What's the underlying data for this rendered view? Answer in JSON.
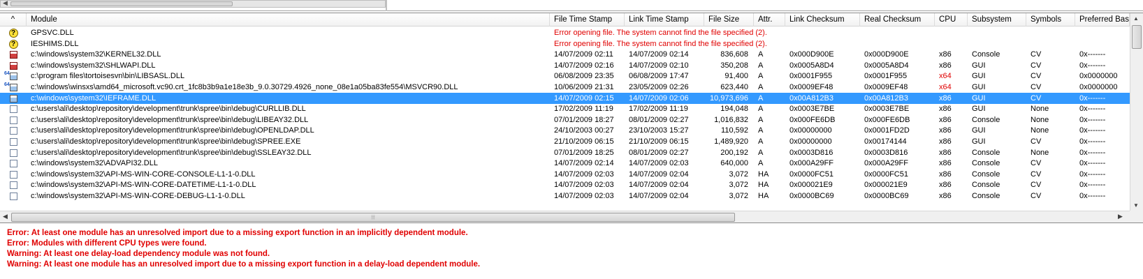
{
  "colors": {
    "error": "#e00000",
    "selection": "#3399ff"
  },
  "list": {
    "sort_indicator": "^",
    "columns": [
      "Module",
      "File Time Stamp",
      "Link Time Stamp",
      "File Size",
      "Attr.",
      "Link Checksum",
      "Real Checksum",
      "CPU",
      "Subsystem",
      "Symbols",
      "Preferred Base"
    ],
    "rows": [
      {
        "icon": "missing-module-icon",
        "module": "GPSVC.DLL",
        "error": "Error opening file. The system cannot find the file specified (2)."
      },
      {
        "icon": "missing-module-icon",
        "module": "IESHIMS.DLL",
        "error": "Error opening file. The system cannot find the file specified (2)."
      },
      {
        "icon": "error-module-icon",
        "module": "c:\\windows\\system32\\KERNEL32.DLL",
        "file_ts": "14/07/2009 02:11",
        "link_ts": "14/07/2009 02:14",
        "size": "836,608",
        "attr": "A",
        "link_cs": "0x000D900E",
        "real_cs": "0x000D900E",
        "cpu": "x86",
        "subsystem": "Console",
        "symbols": "CV",
        "base": "0x-------"
      },
      {
        "icon": "error-module-icon",
        "module": "c:\\windows\\system32\\SHLWAPI.DLL",
        "file_ts": "14/07/2009 02:16",
        "link_ts": "14/07/2009 02:10",
        "size": "350,208",
        "attr": "A",
        "link_cs": "0x0005A8D4",
        "real_cs": "0x0005A8D4",
        "cpu": "x86",
        "subsystem": "GUI",
        "symbols": "CV",
        "base": "0x-------"
      },
      {
        "icon": "module-64bit-icon",
        "module": "c:\\program files\\tortoisesvn\\bin\\LIBSASL.DLL",
        "file_ts": "06/08/2009 23:35",
        "link_ts": "06/08/2009 17:47",
        "size": "91,400",
        "attr": "A",
        "link_cs": "0x0001F955",
        "real_cs": "0x0001F955",
        "cpu": "x64",
        "cpu_warn": true,
        "subsystem": "GUI",
        "symbols": "CV",
        "base": "0x0000000"
      },
      {
        "icon": "module-64bit-icon",
        "module": "c:\\windows\\winsxs\\amd64_microsoft.vc90.crt_1fc8b3b9a1e18e3b_9.0.30729.4926_none_08e1a05ba83fe554\\MSVCR90.DLL",
        "file_ts": "10/06/2009 21:31",
        "link_ts": "23/05/2009 02:26",
        "size": "623,440",
        "attr": "A",
        "link_cs": "0x0009EF48",
        "real_cs": "0x0009EF48",
        "cpu": "x64",
        "cpu_warn": true,
        "subsystem": "GUI",
        "symbols": "CV",
        "base": "0x0000000"
      },
      {
        "icon": "module-selected-icon",
        "module": "c:\\windows\\system32\\IEFRAME.DLL",
        "file_ts": "14/07/2009 02:15",
        "link_ts": "14/07/2009 02:06",
        "size": "10,973,696",
        "attr": "A",
        "link_cs": "0x00A812B3",
        "real_cs": "0x00A812B3",
        "cpu": "x86",
        "subsystem": "GUI",
        "symbols": "CV",
        "base": "0x-------",
        "selected": true
      },
      {
        "icon": "module-icon",
        "module": "c:\\users\\ali\\desktop\\repository\\development\\trunk\\spree\\bin\\debug\\CURLLIB.DLL",
        "file_ts": "17/02/2009 11:19",
        "link_ts": "17/02/2009 11:19",
        "size": "194,048",
        "attr": "A",
        "link_cs": "0x0003E7BE",
        "real_cs": "0x0003E7BE",
        "cpu": "x86",
        "subsystem": "GUI",
        "symbols": "None",
        "base": "0x-------"
      },
      {
        "icon": "module-icon",
        "module": "c:\\users\\ali\\desktop\\repository\\development\\trunk\\spree\\bin\\debug\\LIBEAY32.DLL",
        "file_ts": "07/01/2009 18:27",
        "link_ts": "08/01/2009 02:27",
        "size": "1,016,832",
        "attr": "A",
        "link_cs": "0x000FE6DB",
        "real_cs": "0x000FE6DB",
        "cpu": "x86",
        "subsystem": "Console",
        "symbols": "None",
        "base": "0x-------"
      },
      {
        "icon": "module-icon",
        "module": "c:\\users\\ali\\desktop\\repository\\development\\trunk\\spree\\bin\\debug\\OPENLDAP.DLL",
        "file_ts": "24/10/2003 00:27",
        "link_ts": "23/10/2003 15:27",
        "size": "110,592",
        "attr": "A",
        "link_cs": "0x00000000",
        "real_cs": "0x0001FD2D",
        "cpu": "x86",
        "subsystem": "GUI",
        "symbols": "None",
        "base": "0x-------"
      },
      {
        "icon": "module-icon",
        "module": "c:\\users\\ali\\desktop\\repository\\development\\trunk\\spree\\bin\\debug\\SPREE.EXE",
        "file_ts": "21/10/2009 06:15",
        "link_ts": "21/10/2009 06:15",
        "size": "1,489,920",
        "attr": "A",
        "link_cs": "0x00000000",
        "real_cs": "0x00174144",
        "cpu": "x86",
        "subsystem": "GUI",
        "symbols": "CV",
        "base": "0x-------"
      },
      {
        "icon": "module-icon",
        "module": "c:\\users\\ali\\desktop\\repository\\development\\trunk\\spree\\bin\\debug\\SSLEAY32.DLL",
        "file_ts": "07/01/2009 18:25",
        "link_ts": "08/01/2009 02:27",
        "size": "200,192",
        "attr": "A",
        "link_cs": "0x0003D816",
        "real_cs": "0x0003D816",
        "cpu": "x86",
        "subsystem": "Console",
        "symbols": "None",
        "base": "0x-------"
      },
      {
        "icon": "module-icon",
        "module": "c:\\windows\\system32\\ADVAPI32.DLL",
        "file_ts": "14/07/2009 02:14",
        "link_ts": "14/07/2009 02:03",
        "size": "640,000",
        "attr": "A",
        "link_cs": "0x000A29FF",
        "real_cs": "0x000A29FF",
        "cpu": "x86",
        "subsystem": "Console",
        "symbols": "CV",
        "base": "0x-------"
      },
      {
        "icon": "module-icon",
        "module": "c:\\windows\\system32\\API-MS-WIN-CORE-CONSOLE-L1-1-0.DLL",
        "file_ts": "14/07/2009 02:03",
        "link_ts": "14/07/2009 02:04",
        "size": "3,072",
        "attr": "HA",
        "link_cs": "0x0000FC51",
        "real_cs": "0x0000FC51",
        "cpu": "x86",
        "subsystem": "Console",
        "symbols": "CV",
        "base": "0x-------"
      },
      {
        "icon": "module-icon",
        "module": "c:\\windows\\system32\\API-MS-WIN-CORE-DATETIME-L1-1-0.DLL",
        "file_ts": "14/07/2009 02:03",
        "link_ts": "14/07/2009 02:04",
        "size": "3,072",
        "attr": "HA",
        "link_cs": "0x000021E9",
        "real_cs": "0x000021E9",
        "cpu": "x86",
        "subsystem": "Console",
        "symbols": "CV",
        "base": "0x-------"
      },
      {
        "icon": "module-icon",
        "module": "c:\\windows\\system32\\API-MS-WIN-CORE-DEBUG-L1-1-0.DLL",
        "file_ts": "14/07/2009 02:03",
        "link_ts": "14/07/2009 02:04",
        "size": "3,072",
        "attr": "HA",
        "link_cs": "0x0000BC69",
        "real_cs": "0x0000BC69",
        "cpu": "x86",
        "subsystem": "Console",
        "symbols": "CV",
        "base": "0x-------"
      }
    ]
  },
  "log": {
    "messages": [
      "Error: At least one module has an unresolved import due to a missing export function in an implicitly dependent module.",
      "Error: Modules with different CPU types were found.",
      "Warning: At least one delay-load dependency module was not found.",
      "Warning: At least one module has an unresolved import due to a missing export function in a delay-load dependent module."
    ]
  }
}
